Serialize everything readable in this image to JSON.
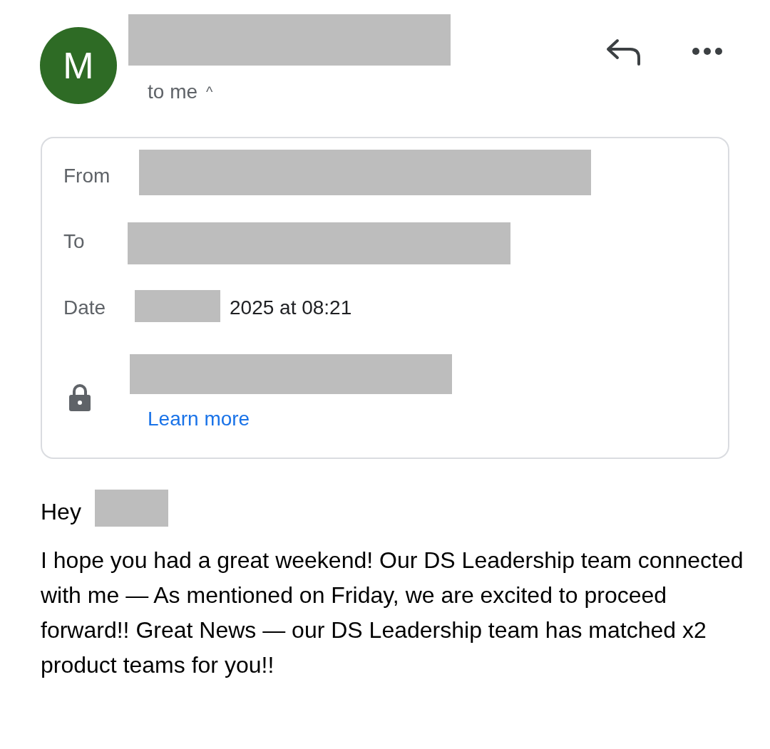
{
  "sender": {
    "avatar_letter": "M",
    "recipient_summary": "to me",
    "expander": "^"
  },
  "details": {
    "from_label": "From",
    "to_label": "To",
    "date_label": "Date",
    "date_value": "2025 at 08:21",
    "learn_more": "Learn more"
  },
  "body": {
    "greeting": "Hey",
    "paragraph": "I hope you had a great weekend! Our DS Leadership team connected with me — As mentioned on Friday, we are excited to proceed forward!! Great News — our DS Leadership team has matched x2 product teams for you!!"
  }
}
